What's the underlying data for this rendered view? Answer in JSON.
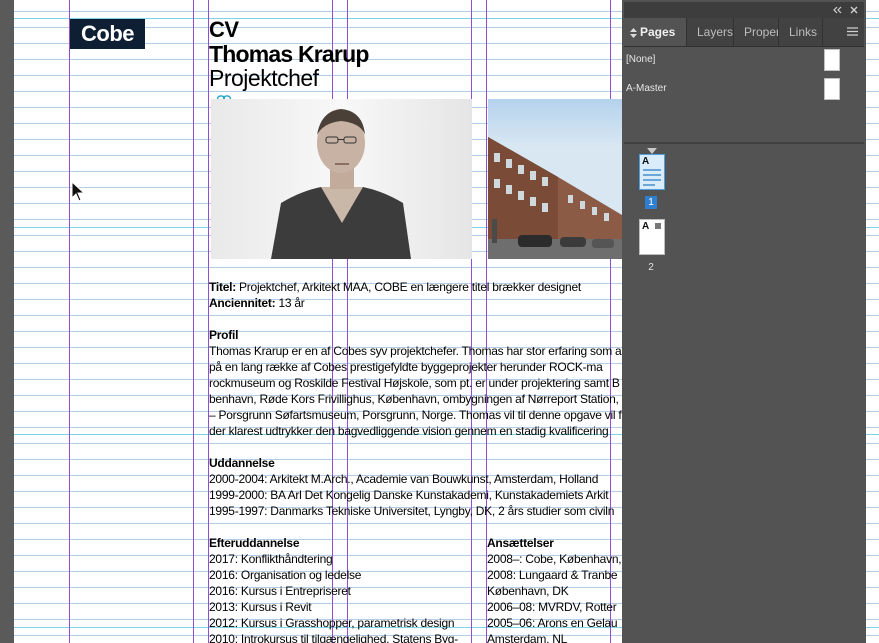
{
  "logo": {
    "text": "Cobe"
  },
  "cv_header": {
    "line1": "CV",
    "line2": "Thomas Krarup",
    "line3": "Projektchef"
  },
  "body": {
    "title_label": "Titel:",
    "title_value": "Projektchef, Arkitekt MAA, COBE en længere titel brækker designet",
    "seniority_label": "Anciennitet:",
    "seniority_value": "13 år",
    "profile_heading": "Profil",
    "profile_lines": [
      "Thomas Krarup er en af Cobes syv projektchefer. Thomas har stor erfaring som a",
      "på en lang række af Cobes prestigefyldte byggeprojekter herunder ROCK-ma",
      "rockmuseum og Roskilde Festival Højskole, som pt. er under projektering samt B",
      "benhavn, Røde Kors Frivillighus, København, ombygningen af Nørreport Station, K",
      "– Porsgrunn Søfartsmuseum, Porsgrunn, Norge. Thomas vil til denne opgave vil f",
      "der klarest udtrykker den bagvedliggende vision gennem en stadig kvalificering"
    ],
    "education_heading": "Uddannelse",
    "education_lines": [
      "2000-2004: Arkitekt M.Arch., Academie van Bouwkunst, Amsterdam, Holland",
      "1999-2000: BA Arl Det Kongelig Danske Kunstakademi, Kunstakademiets Arkit",
      "1995-1997: Danmarks Tekniske Universitet, Lyngby, DK, 2 års studier som civiln"
    ],
    "further_heading": "Efteruddannelse",
    "further_lines": [
      "2017: Konflikthåndtering",
      "2016: Organisation og ledelse",
      "2016: Kursus i Entrepriseret",
      "2013: Kursus i Revit",
      "2012: Kursus i Grasshopper, parametrisk design",
      "2010: Introkursus til tilgængelighed, Statens Byg-"
    ],
    "employment_heading": "Ansættelser",
    "employment_lines": [
      "2008–: Cobe, København,",
      "2008: Lungaard & Tranbe",
      "København, DK",
      "2006–08: MVRDV, Rotter",
      "2005–06: Arons en Gelau",
      "Amsterdam, NL"
    ]
  },
  "panel": {
    "tabs": [
      "Pages",
      "Layers",
      "Proper",
      "Links"
    ],
    "active_tab": "Pages",
    "masters": [
      "[None]",
      "A-Master"
    ],
    "pages": [
      {
        "number": "1",
        "master": "A"
      },
      {
        "number": "2",
        "master": "A"
      }
    ],
    "icons": {
      "collapse": "double-chevron-left-icon",
      "close": "close-icon",
      "menu": "hamburger-icon"
    }
  }
}
